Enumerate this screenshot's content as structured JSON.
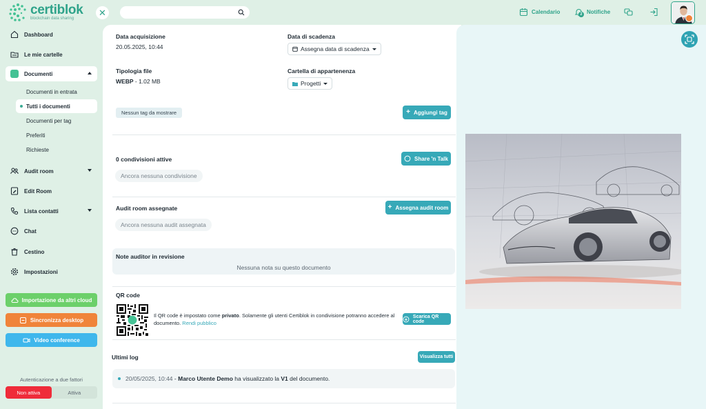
{
  "app": {
    "name": "certiblok",
    "tagline": "blockchain data sharing"
  },
  "search": {
    "value": "",
    "placeholder": ""
  },
  "top_actions": {
    "calendar": "Calendario",
    "notifications": "Notifiche",
    "notification_count": "2"
  },
  "sidebar": {
    "items": [
      {
        "label": "Dashboard"
      },
      {
        "label": "Le mie cartelle"
      },
      {
        "label": "Documenti"
      },
      {
        "label": "Audit room"
      },
      {
        "label": "Edit Room"
      },
      {
        "label": "Lista contatti"
      },
      {
        "label": "Chat"
      },
      {
        "label": "Cestino"
      },
      {
        "label": "Impostazioni"
      }
    ],
    "documenti_sub": [
      {
        "label": "Documenti in entrata"
      },
      {
        "label": "Tutti i documenti"
      },
      {
        "label": "Documenti per tag"
      },
      {
        "label": "Preferiti"
      },
      {
        "label": "Richieste"
      }
    ],
    "buttons": {
      "cloud_import": "Importazione da altri cloud",
      "desktop_sync": "Sincronizza desktop",
      "video_conference": "Video conference"
    },
    "twofa": {
      "label": "Autenticazione a due fattori",
      "off": "Non attiva",
      "on": "Attiva"
    }
  },
  "document": {
    "acquisition_label": "Data acquisizione",
    "acquisition_value": "20.05.2025, 10:44",
    "expiry_label": "Data di scadenza",
    "expiry_button": "Assegna data di scadenza",
    "file_type_label": "Tipologia file",
    "file_type": "WEBP",
    "file_size": "- 1.02 MB",
    "folder_label": "Cartella di appartenenza",
    "folder_value": "Progetti",
    "no_tags": "Nessun tag da mostrare",
    "add_tag": "Aggiungi tag"
  },
  "sharing": {
    "title": "0 condivisioni attive",
    "empty": "Ancora nessuna condivisione",
    "button": "Share 'n Talk"
  },
  "audit": {
    "title": "Audit room assegnate",
    "empty": "Ancora nessuna audit assegnata",
    "button": "Assegna audit room"
  },
  "notes": {
    "title": "Note auditor in revisione",
    "empty": "Nessuna nota su questo documento"
  },
  "qr": {
    "title": "QR code",
    "text_before": "Il QR code è impostato come ",
    "text_bold": "privato",
    "text_after": ". Solamente gli utenti Certiblok in condivisione potranno accedere al documento. ",
    "link": "Rendi pubblico",
    "download": "Scarica QR code"
  },
  "logs": {
    "title": "Ultimi log",
    "view_all": "Visualizza tutti",
    "entries": [
      {
        "date": "20/05/2025, 10:44",
        "sep": " - ",
        "user": "Marco Utente Demo",
        "action": " ha visualizzato la ",
        "version": "V1",
        "suffix": " del documento."
      }
    ]
  },
  "colors": {
    "brand": "#2fa38a",
    "accent": "#37a9b8",
    "sidebar_bg": "#dff0e6",
    "cloud_button": "#6cd06a",
    "desktop_button": "#f0843a",
    "video_button": "#3fb7ec",
    "twofa_off": "#ef2c3a"
  }
}
